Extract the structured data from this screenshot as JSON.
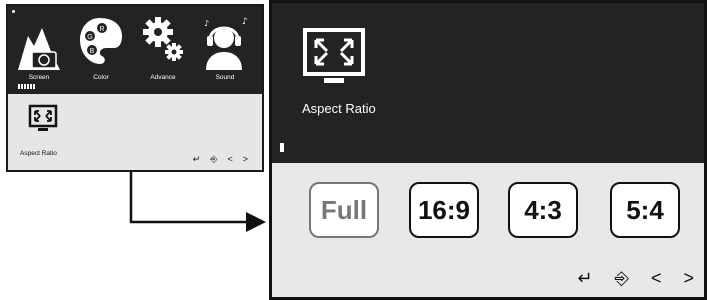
{
  "small_osd": {
    "tabs": [
      {
        "label": "Screen",
        "icon": "landscape-camera-icon"
      },
      {
        "label": "Color",
        "icon": "palette-icon"
      },
      {
        "label": "Advance",
        "icon": "gears-icon"
      },
      {
        "label": "Sound",
        "icon": "headphones-icon"
      }
    ],
    "submenu_item": {
      "label": "Aspect Ratio",
      "icon": "aspect-ratio-icon"
    },
    "nav": {
      "enter": "↵",
      "exit": "⎆",
      "prev": "<",
      "next": ">"
    }
  },
  "large_osd": {
    "title": "Aspect Ratio",
    "options": [
      {
        "label": "Full",
        "state": "dimmed"
      },
      {
        "label": "16:9",
        "state": "normal"
      },
      {
        "label": "4:3",
        "state": "normal"
      },
      {
        "label": "5:4",
        "state": "normal"
      }
    ],
    "nav": {
      "enter": "↵",
      "exit": "⎆",
      "prev": "<",
      "next": ">"
    }
  },
  "colors": {
    "osd_dark": "#232323",
    "osd_light": "#e8e8e8",
    "accent": "#111111"
  }
}
